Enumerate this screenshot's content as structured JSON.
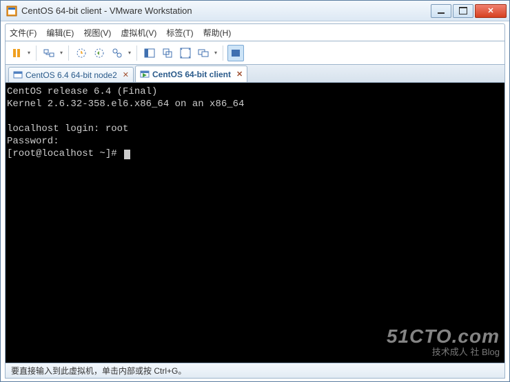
{
  "window": {
    "title": "CentOS 64-bit client - VMware Workstation"
  },
  "menu": {
    "file": "文件(F)",
    "edit": "编辑(E)",
    "view": "视图(V)",
    "vm": "虚拟机(V)",
    "tabs": "标签(T)",
    "help": "帮助(H)"
  },
  "tabs": [
    {
      "label": "CentOS 6.4 64-bit node2",
      "active": false
    },
    {
      "label": "CentOS 64-bit client",
      "active": true
    }
  ],
  "console": {
    "line1": "CentOS release 6.4 (Final)",
    "line2": "Kernel 2.6.32-358.el6.x86_64 on an x86_64",
    "line3": "",
    "login_prompt": "localhost login: ",
    "login_user": "root",
    "pass_prompt": "Password:",
    "shell_prompt": "[root@localhost ~]# "
  },
  "statusbar": {
    "text": "要直接输入到此虚拟机，单击内部或按 Ctrl+G。"
  },
  "watermark": {
    "brand": "51CTO.com",
    "sub": "技术成人 社 Blog"
  }
}
